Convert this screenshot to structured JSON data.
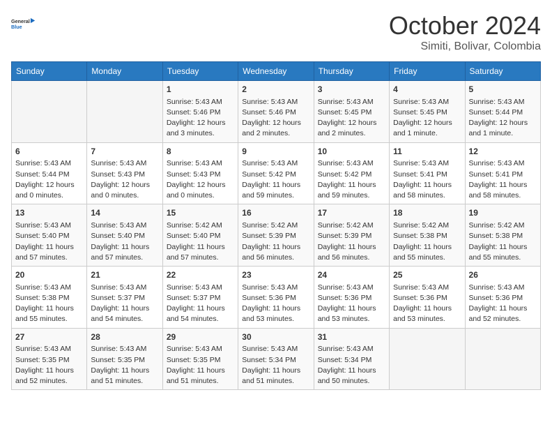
{
  "header": {
    "logo_general": "General",
    "logo_blue": "Blue",
    "month": "October 2024",
    "location": "Simiti, Bolivar, Colombia"
  },
  "weekdays": [
    "Sunday",
    "Monday",
    "Tuesday",
    "Wednesday",
    "Thursday",
    "Friday",
    "Saturday"
  ],
  "weeks": [
    [
      {
        "day": null
      },
      {
        "day": null
      },
      {
        "day": "1",
        "sunrise": "Sunrise: 5:43 AM",
        "sunset": "Sunset: 5:46 PM",
        "daylight": "Daylight: 12 hours and 3 minutes."
      },
      {
        "day": "2",
        "sunrise": "Sunrise: 5:43 AM",
        "sunset": "Sunset: 5:46 PM",
        "daylight": "Daylight: 12 hours and 2 minutes."
      },
      {
        "day": "3",
        "sunrise": "Sunrise: 5:43 AM",
        "sunset": "Sunset: 5:45 PM",
        "daylight": "Daylight: 12 hours and 2 minutes."
      },
      {
        "day": "4",
        "sunrise": "Sunrise: 5:43 AM",
        "sunset": "Sunset: 5:45 PM",
        "daylight": "Daylight: 12 hours and 1 minute."
      },
      {
        "day": "5",
        "sunrise": "Sunrise: 5:43 AM",
        "sunset": "Sunset: 5:44 PM",
        "daylight": "Daylight: 12 hours and 1 minute."
      }
    ],
    [
      {
        "day": "6",
        "sunrise": "Sunrise: 5:43 AM",
        "sunset": "Sunset: 5:44 PM",
        "daylight": "Daylight: 12 hours and 0 minutes."
      },
      {
        "day": "7",
        "sunrise": "Sunrise: 5:43 AM",
        "sunset": "Sunset: 5:43 PM",
        "daylight": "Daylight: 12 hours and 0 minutes."
      },
      {
        "day": "8",
        "sunrise": "Sunrise: 5:43 AM",
        "sunset": "Sunset: 5:43 PM",
        "daylight": "Daylight: 12 hours and 0 minutes."
      },
      {
        "day": "9",
        "sunrise": "Sunrise: 5:43 AM",
        "sunset": "Sunset: 5:42 PM",
        "daylight": "Daylight: 11 hours and 59 minutes."
      },
      {
        "day": "10",
        "sunrise": "Sunrise: 5:43 AM",
        "sunset": "Sunset: 5:42 PM",
        "daylight": "Daylight: 11 hours and 59 minutes."
      },
      {
        "day": "11",
        "sunrise": "Sunrise: 5:43 AM",
        "sunset": "Sunset: 5:41 PM",
        "daylight": "Daylight: 11 hours and 58 minutes."
      },
      {
        "day": "12",
        "sunrise": "Sunrise: 5:43 AM",
        "sunset": "Sunset: 5:41 PM",
        "daylight": "Daylight: 11 hours and 58 minutes."
      }
    ],
    [
      {
        "day": "13",
        "sunrise": "Sunrise: 5:43 AM",
        "sunset": "Sunset: 5:40 PM",
        "daylight": "Daylight: 11 hours and 57 minutes."
      },
      {
        "day": "14",
        "sunrise": "Sunrise: 5:43 AM",
        "sunset": "Sunset: 5:40 PM",
        "daylight": "Daylight: 11 hours and 57 minutes."
      },
      {
        "day": "15",
        "sunrise": "Sunrise: 5:42 AM",
        "sunset": "Sunset: 5:40 PM",
        "daylight": "Daylight: 11 hours and 57 minutes."
      },
      {
        "day": "16",
        "sunrise": "Sunrise: 5:42 AM",
        "sunset": "Sunset: 5:39 PM",
        "daylight": "Daylight: 11 hours and 56 minutes."
      },
      {
        "day": "17",
        "sunrise": "Sunrise: 5:42 AM",
        "sunset": "Sunset: 5:39 PM",
        "daylight": "Daylight: 11 hours and 56 minutes."
      },
      {
        "day": "18",
        "sunrise": "Sunrise: 5:42 AM",
        "sunset": "Sunset: 5:38 PM",
        "daylight": "Daylight: 11 hours and 55 minutes."
      },
      {
        "day": "19",
        "sunrise": "Sunrise: 5:42 AM",
        "sunset": "Sunset: 5:38 PM",
        "daylight": "Daylight: 11 hours and 55 minutes."
      }
    ],
    [
      {
        "day": "20",
        "sunrise": "Sunrise: 5:43 AM",
        "sunset": "Sunset: 5:38 PM",
        "daylight": "Daylight: 11 hours and 55 minutes."
      },
      {
        "day": "21",
        "sunrise": "Sunrise: 5:43 AM",
        "sunset": "Sunset: 5:37 PM",
        "daylight": "Daylight: 11 hours and 54 minutes."
      },
      {
        "day": "22",
        "sunrise": "Sunrise: 5:43 AM",
        "sunset": "Sunset: 5:37 PM",
        "daylight": "Daylight: 11 hours and 54 minutes."
      },
      {
        "day": "23",
        "sunrise": "Sunrise: 5:43 AM",
        "sunset": "Sunset: 5:36 PM",
        "daylight": "Daylight: 11 hours and 53 minutes."
      },
      {
        "day": "24",
        "sunrise": "Sunrise: 5:43 AM",
        "sunset": "Sunset: 5:36 PM",
        "daylight": "Daylight: 11 hours and 53 minutes."
      },
      {
        "day": "25",
        "sunrise": "Sunrise: 5:43 AM",
        "sunset": "Sunset: 5:36 PM",
        "daylight": "Daylight: 11 hours and 53 minutes."
      },
      {
        "day": "26",
        "sunrise": "Sunrise: 5:43 AM",
        "sunset": "Sunset: 5:36 PM",
        "daylight": "Daylight: 11 hours and 52 minutes."
      }
    ],
    [
      {
        "day": "27",
        "sunrise": "Sunrise: 5:43 AM",
        "sunset": "Sunset: 5:35 PM",
        "daylight": "Daylight: 11 hours and 52 minutes."
      },
      {
        "day": "28",
        "sunrise": "Sunrise: 5:43 AM",
        "sunset": "Sunset: 5:35 PM",
        "daylight": "Daylight: 11 hours and 51 minutes."
      },
      {
        "day": "29",
        "sunrise": "Sunrise: 5:43 AM",
        "sunset": "Sunset: 5:35 PM",
        "daylight": "Daylight: 11 hours and 51 minutes."
      },
      {
        "day": "30",
        "sunrise": "Sunrise: 5:43 AM",
        "sunset": "Sunset: 5:34 PM",
        "daylight": "Daylight: 11 hours and 51 minutes."
      },
      {
        "day": "31",
        "sunrise": "Sunrise: 5:43 AM",
        "sunset": "Sunset: 5:34 PM",
        "daylight": "Daylight: 11 hours and 50 minutes."
      },
      {
        "day": null
      },
      {
        "day": null
      }
    ]
  ]
}
